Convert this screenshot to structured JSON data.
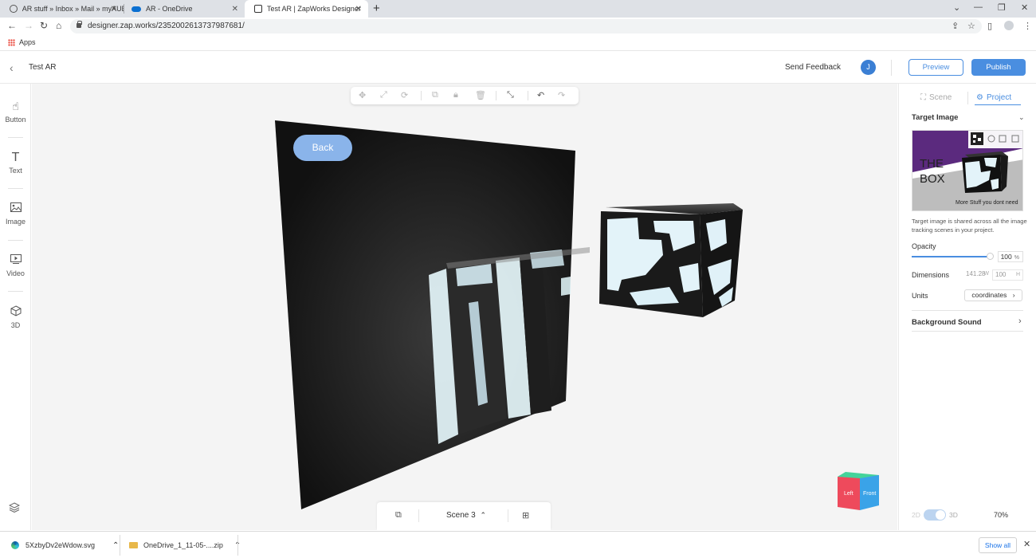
{
  "browser": {
    "tabs": [
      {
        "title": "AR stuff » Inbox » Mail » myAUB",
        "icon": "globe-icon"
      },
      {
        "title": "AR - OneDrive",
        "icon": "onedrive-cloud-icon"
      },
      {
        "title": "Test AR | ZapWorks Designer",
        "icon": "zapworks-icon"
      }
    ],
    "url": "designer.zap.works/2352002613737987681/",
    "bookmark_apps": "Apps"
  },
  "header": {
    "project_title": "Test AR",
    "send_feedback": "Send Feedback",
    "user_initial": "J",
    "preview_label": "Preview",
    "publish_label": "Publish"
  },
  "tools": [
    {
      "label": "Button",
      "icon": "hand-pointer-icon"
    },
    {
      "label": "Text",
      "icon": "text-t-icon"
    },
    {
      "label": "Image",
      "icon": "image-icon"
    },
    {
      "label": "Video",
      "icon": "video-icon"
    },
    {
      "label": "3D",
      "icon": "cube-icon"
    }
  ],
  "canvas": {
    "back_button": "Back",
    "scene_label": "Scene 3",
    "viewcube": {
      "left": "Left",
      "front": "Front"
    }
  },
  "panel": {
    "tab_scene": "Scene",
    "tab_project": "Project",
    "target_image_title": "Target Image",
    "target_text_1": "THE",
    "target_text_2": "BOX",
    "target_caption": "More Stuff you dont need",
    "target_note": "Target image is shared across all the image tracking scenes in your project.",
    "opacity_label": "Opacity",
    "opacity_value": "100",
    "opacity_unit": "%",
    "dimensions_label": "Dimensions",
    "dim_w": "141.28",
    "dim_w_unit": "W",
    "dim_h": "100",
    "dim_h_unit": "H",
    "units_label": "Units",
    "units_value": "coordinates",
    "background_sound": "Background Sound",
    "toggle_2d": "2D",
    "toggle_3d": "3D",
    "zoom": "70%"
  },
  "downloads": [
    {
      "name": "5XzbyDv2eWdow.svg",
      "icon": "edge-browser-icon"
    },
    {
      "name": "OneDrive_1_11-05-....zip",
      "icon": "folder-zip-icon"
    }
  ],
  "show_all": "Show all",
  "colors": {
    "accent": "#4a8ee0",
    "purple_band": "#5b2a7e",
    "viewcube_left": "#ee4a5c",
    "viewcube_front": "#3aa3e8",
    "viewcube_top": "#44d39a"
  }
}
